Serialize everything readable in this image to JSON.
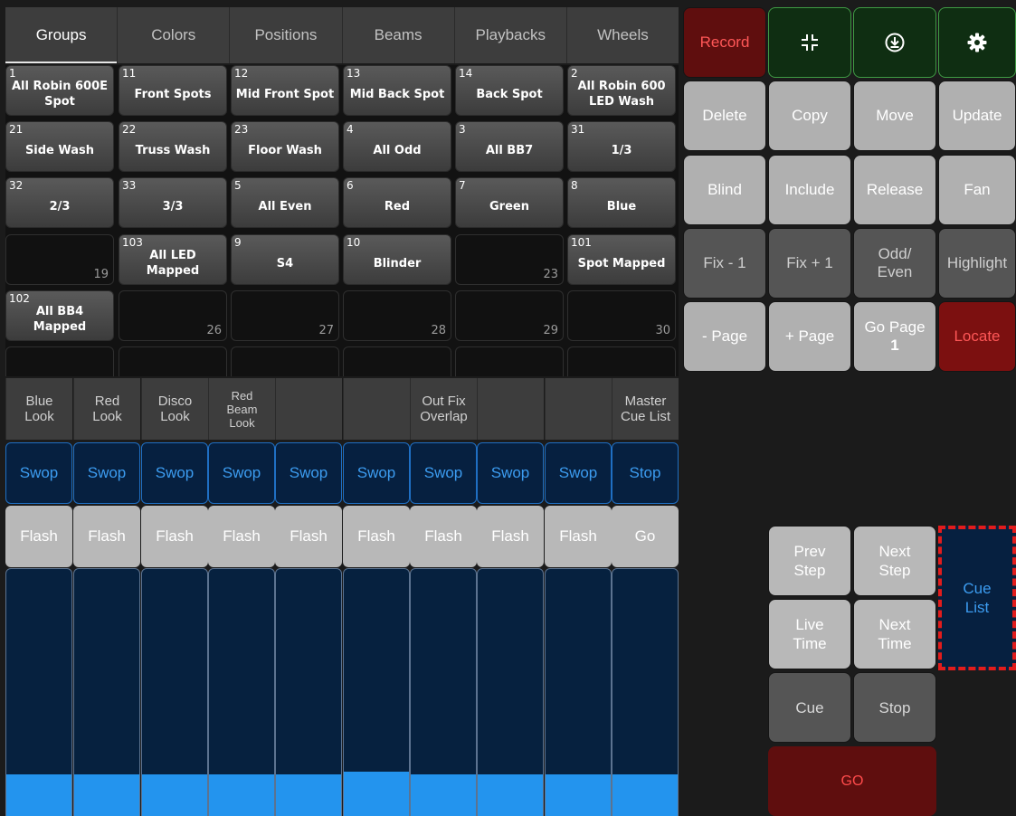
{
  "tabs": [
    "Groups",
    "Colors",
    "Positions",
    "Beams",
    "Playbacks",
    "Wheels"
  ],
  "groups": [
    {
      "num": "1",
      "label": "All Robin 600E Spot"
    },
    {
      "num": "11",
      "label": "Front Spots"
    },
    {
      "num": "12",
      "label": "Mid Front Spot"
    },
    {
      "num": "13",
      "label": "Mid Back Spot"
    },
    {
      "num": "14",
      "label": "Back Spot"
    },
    {
      "num": "2",
      "label": "All Robin 600 LED Wash"
    },
    {
      "num": "21",
      "label": "Side Wash"
    },
    {
      "num": "22",
      "label": "Truss Wash"
    },
    {
      "num": "23",
      "label": "Floor Wash"
    },
    {
      "num": "4",
      "label": "All Odd"
    },
    {
      "num": "3",
      "label": "All BB7"
    },
    {
      "num": "31",
      "label": "1/3"
    },
    {
      "num": "32",
      "label": "2/3"
    },
    {
      "num": "33",
      "label": "3/3"
    },
    {
      "num": "5",
      "label": "All Even"
    },
    {
      "num": "6",
      "label": "Red"
    },
    {
      "num": "7",
      "label": "Green"
    },
    {
      "num": "8",
      "label": "Blue"
    },
    {
      "num": "",
      "label": "",
      "corner": "19"
    },
    {
      "num": "103",
      "label": "All LED Mapped"
    },
    {
      "num": "9",
      "label": "S4"
    },
    {
      "num": "10",
      "label": "Blinder"
    },
    {
      "num": "",
      "label": "",
      "corner": "23"
    },
    {
      "num": "101",
      "label": "Spot Mapped"
    },
    {
      "num": "102",
      "label": "All BB4 Mapped"
    },
    {
      "num": "",
      "label": "",
      "corner": "26"
    },
    {
      "num": "",
      "label": "",
      "corner": "27"
    },
    {
      "num": "",
      "label": "",
      "corner": "28"
    },
    {
      "num": "",
      "label": "",
      "corner": "29"
    },
    {
      "num": "",
      "label": "",
      "corner": "30"
    }
  ],
  "commands": {
    "record": "Record",
    "delete": "Delete",
    "copy": "Copy",
    "move": "Move",
    "update": "Update",
    "blind": "Blind",
    "include": "Include",
    "release": "Release",
    "fan": "Fan",
    "fix_minus": "Fix - 1",
    "fix_plus": "Fix + 1",
    "odd_even": "Odd/\nEven",
    "highlight": "Highlight",
    "page_minus": "- Page",
    "page_plus": "+ Page",
    "go_page": "Go Page",
    "go_page_num": "1",
    "locate": "Locate",
    "icons": [
      "collapse-icon",
      "download-circle-icon",
      "gear-icon"
    ]
  },
  "playbacks": [
    {
      "label": "Blue\nLook",
      "swop": "Swop",
      "flash": "Flash",
      "level": 0.17
    },
    {
      "label": "Red\nLook",
      "swop": "Swop",
      "flash": "Flash",
      "level": 0.17
    },
    {
      "label": "Disco\nLook",
      "swop": "Swop",
      "flash": "Flash",
      "level": 0.17
    },
    {
      "label": "Red\nBeam\nLook",
      "swop": "Swop",
      "flash": "Flash",
      "level": 0.17
    },
    {
      "label": "",
      "swop": "Swop",
      "flash": "Flash",
      "level": 0.17
    },
    {
      "label": "",
      "swop": "Swop",
      "flash": "Flash",
      "level": 0.18
    },
    {
      "label": "Out Fix\nOverlap",
      "swop": "Swop",
      "flash": "Flash",
      "level": 0.17
    },
    {
      "label": "",
      "swop": "Swop",
      "flash": "Flash",
      "level": 0.17
    },
    {
      "label": "",
      "swop": "Swop",
      "flash": "Flash",
      "level": 0.17
    },
    {
      "label": "Master\nCue List",
      "swop": "Stop",
      "flash": "Go",
      "level": 0.17
    }
  ],
  "controls": {
    "prev_step": "Prev\nStep",
    "next_step": "Next\nStep",
    "live_time": "Live\nTime",
    "next_time": "Next\nTime",
    "cue": "Cue",
    "stop": "Stop",
    "go": "GO",
    "cue_list": "Cue\nList"
  },
  "colors": {
    "accent_blue": "#3c9cf0",
    "record_red": "#ff5757",
    "fader_fill": "#2394ee"
  }
}
